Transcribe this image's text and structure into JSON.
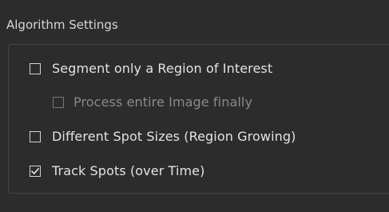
{
  "section": {
    "title": "Algorithm Settings"
  },
  "options": {
    "segment_roi": {
      "label": "Segment only a Region of Interest",
      "checked": false,
      "enabled": true
    },
    "process_entire": {
      "label": "Process entire Image finally",
      "checked": false,
      "enabled": false
    },
    "different_spot_sizes": {
      "label": "Different Spot Sizes (Region Growing)",
      "checked": false,
      "enabled": true
    },
    "track_spots": {
      "label": "Track Spots (over Time)",
      "checked": true,
      "enabled": true
    }
  },
  "icons": {
    "checkbox_unchecked": "checkbox-icon",
    "checkbox_checked": "checkmark-icon"
  },
  "colors": {
    "background": "#2c2c2c",
    "text": "#e3e3e3",
    "disabled_text": "#8a8a8a",
    "border": "#454545"
  }
}
